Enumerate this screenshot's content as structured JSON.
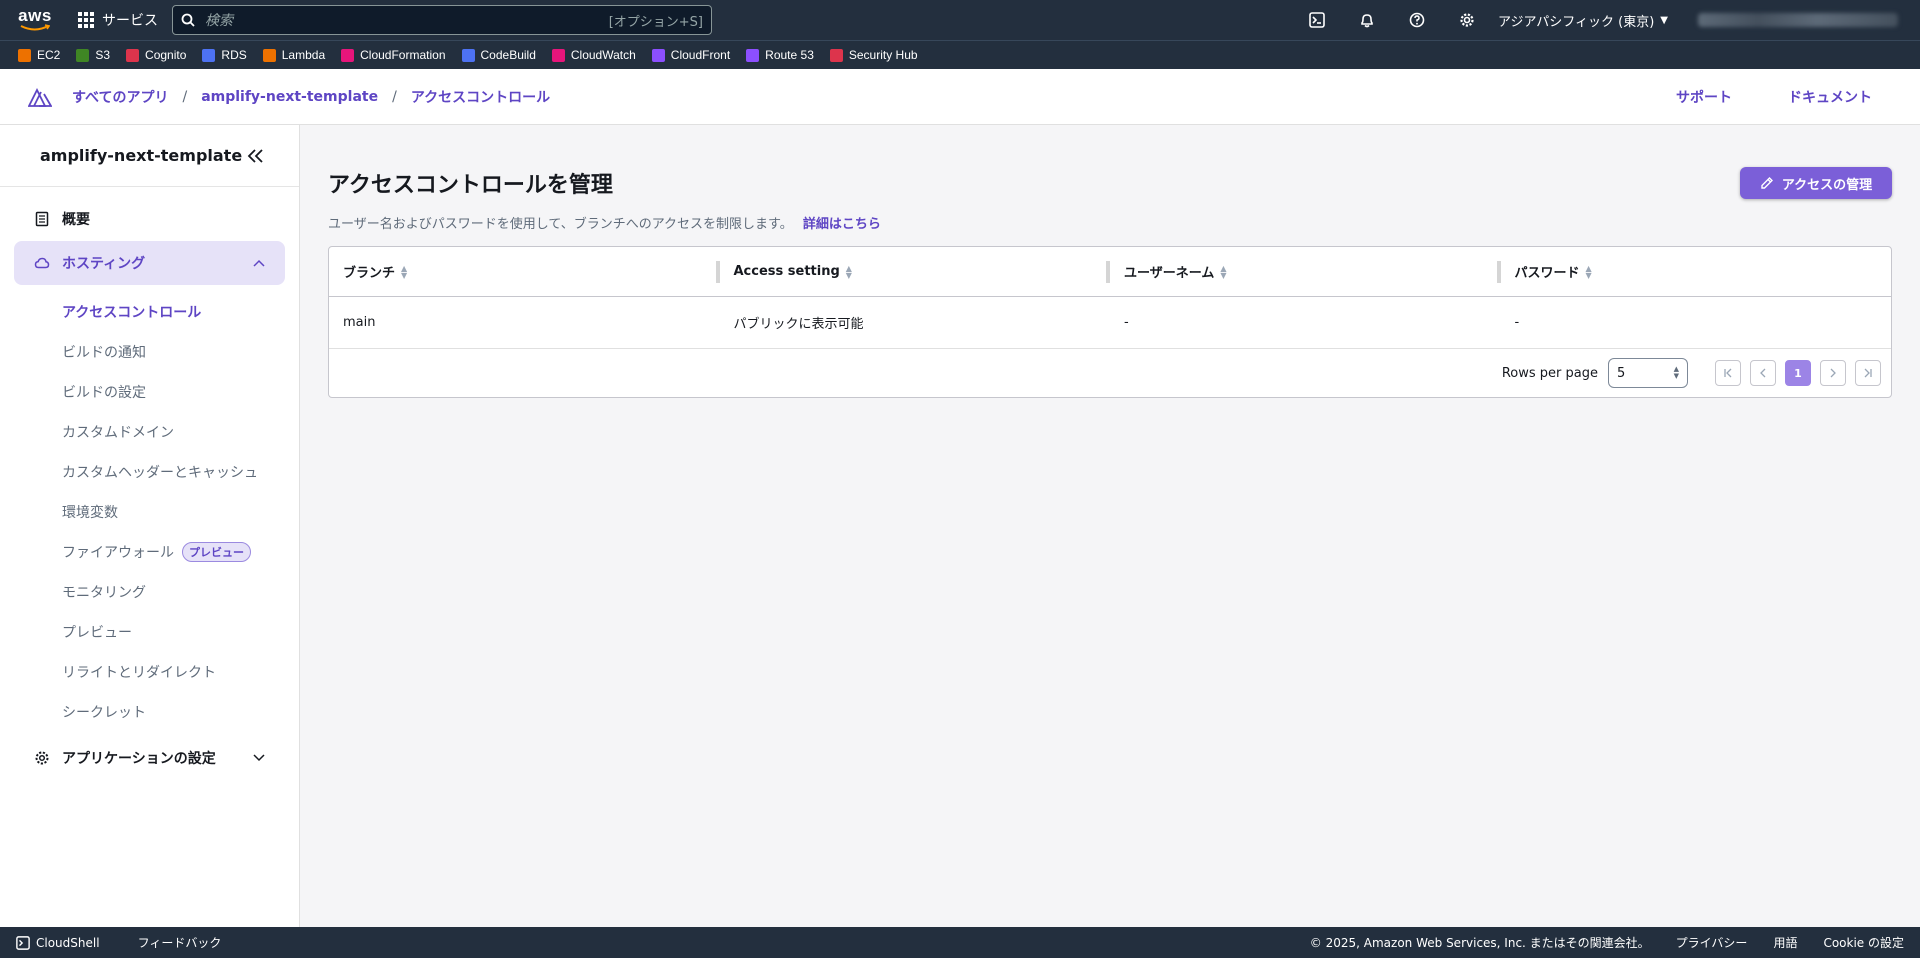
{
  "topnav": {
    "logo_text": "aws",
    "services_label": "サービス",
    "search_placeholder": "検索",
    "search_shortcut": "[オプション+S]",
    "region_label": "アジアパシフィック (東京)"
  },
  "favorites": [
    {
      "label": "EC2",
      "color": "#ed7100"
    },
    {
      "label": "S3",
      "color": "#3f8624"
    },
    {
      "label": "Cognito",
      "color": "#dd344c"
    },
    {
      "label": "RDS",
      "color": "#4d72f3"
    },
    {
      "label": "Lambda",
      "color": "#ed7100"
    },
    {
      "label": "CloudFormation",
      "color": "#e7157b"
    },
    {
      "label": "CodeBuild",
      "color": "#4d72f3"
    },
    {
      "label": "CloudWatch",
      "color": "#e7157b"
    },
    {
      "label": "CloudFront",
      "color": "#8c4fff"
    },
    {
      "label": "Route 53",
      "color": "#8c4fff"
    },
    {
      "label": "Security Hub",
      "color": "#dd344c"
    }
  ],
  "app_header": {
    "crumbs": [
      "すべてのアプリ",
      "amplify-next-template",
      "アクセスコントロール"
    ],
    "separator": "/",
    "support": "サポート",
    "docs": "ドキュメント"
  },
  "sidebar": {
    "title": "amplify-next-template",
    "overview": "概要",
    "hosting": "ホスティング",
    "sub_items": [
      "アクセスコントロール",
      "ビルドの通知",
      "ビルドの設定",
      "カスタムドメイン",
      "カスタムヘッダーとキャッシュ",
      "環境変数",
      "ファイアウォール",
      "モニタリング",
      "プレビュー",
      "リライトとリダイレクト",
      "シークレット"
    ],
    "preview_badge": "プレビュー",
    "app_settings": "アプリケーションの設定"
  },
  "main": {
    "title": "アクセスコントロールを管理",
    "description": "ユーザー名およびパスワードを使用して、ブランチへのアクセスを制限します。",
    "learn_more": "詳細はこちら",
    "manage_button": "アクセスの管理",
    "columns": [
      "ブランチ",
      "Access setting",
      "ユーザーネーム",
      "パスワード"
    ],
    "rows": [
      [
        "main",
        "パブリックに表示可能",
        "-",
        "-"
      ]
    ],
    "rows_per_page_label": "Rows per page",
    "rows_per_page_value": "5",
    "current_page": "1"
  },
  "footer": {
    "cloudshell": "CloudShell",
    "feedback": "フィードバック",
    "copyright": "© 2025, Amazon Web Services, Inc. またはその関連会社。",
    "privacy": "プライバシー",
    "terms": "用語",
    "cookie": "Cookie の設定"
  },
  "colors": {
    "accent": "#5e45c4",
    "nav_bg": "#232f3e",
    "button": "#7b5fd8"
  }
}
